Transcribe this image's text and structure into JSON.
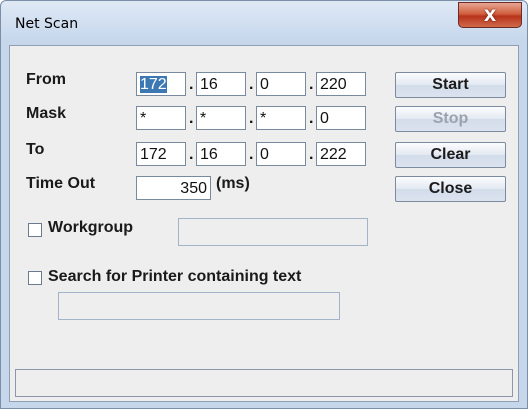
{
  "window": {
    "title": "Net Scan",
    "close_glyph": "X",
    "close_icon": "close-icon"
  },
  "from": {
    "label": "From",
    "octets": [
      "172",
      "16",
      "0",
      "220"
    ]
  },
  "mask": {
    "label": "Mask",
    "octets": [
      "*",
      "*",
      "*",
      "0"
    ]
  },
  "to": {
    "label": "To",
    "octets": [
      "172",
      "16",
      "0",
      "222"
    ]
  },
  "timeout": {
    "label": "Time Out",
    "value": "350",
    "unit": "(ms)"
  },
  "separator": ".",
  "buttons": {
    "start": "Start",
    "stop": "Stop",
    "clear": "Clear",
    "close": "Close"
  },
  "workgroup": {
    "label": "Workgroup",
    "value": "",
    "checked": false
  },
  "printer": {
    "label": "Search for Printer containing text",
    "value": "",
    "checked": false
  },
  "status": {
    "text": ""
  }
}
